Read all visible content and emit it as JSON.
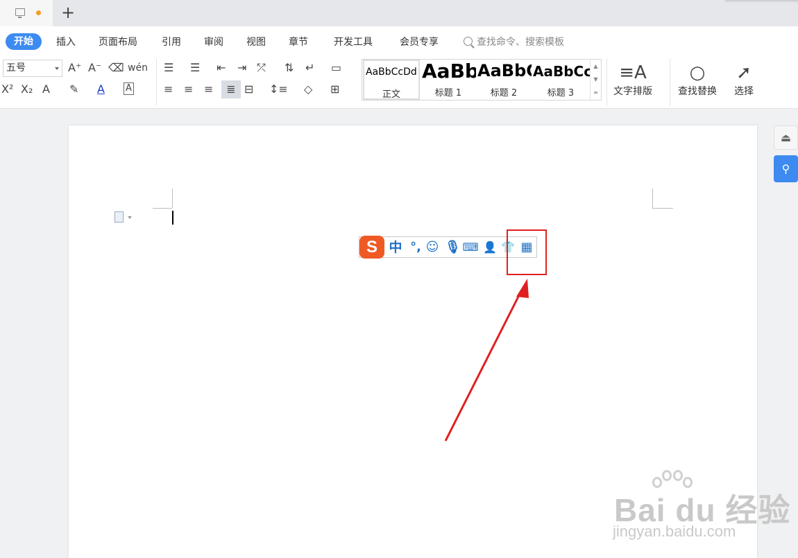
{
  "tabbar": {
    "new_tab": "+"
  },
  "menu": {
    "items": [
      "开始",
      "插入",
      "页面布局",
      "引用",
      "审阅",
      "视图",
      "章节",
      "开发工具",
      "会员专享"
    ],
    "search": "查找命令、搜索模板"
  },
  "ribbon": {
    "font_size": "五号",
    "font_size_options": [
      "五号"
    ],
    "styles": [
      {
        "sample": "AaBbCcDd",
        "label": "正文"
      },
      {
        "sample": "AaBb",
        "label": "标题 1"
      },
      {
        "sample": "AaBbC",
        "label": "标题 2"
      },
      {
        "sample": "AaBbCc",
        "label": "标题 3"
      }
    ],
    "text_layout": "文字排版",
    "find_replace": "查找替换",
    "select": "选择"
  },
  "ime": {
    "logo": "S",
    "mode": "中",
    "punct": "°,"
  },
  "watermark": {
    "brand": "Bai du 经验",
    "url": "jingyan.baidu.com"
  },
  "colors": {
    "accent": "#3d8bf0",
    "ime_logo": "#ef5a24",
    "ime_icons": "#1f72c6",
    "annotation": "#e02020"
  }
}
